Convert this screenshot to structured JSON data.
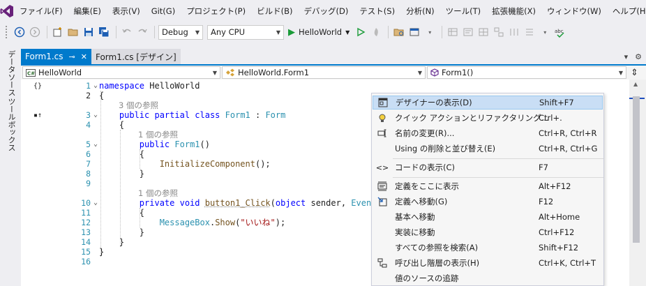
{
  "menu": [
    "ファイル(F)",
    "編集(E)",
    "表示(V)",
    "Git(G)",
    "プロジェクト(P)",
    "ビルド(B)",
    "デバッグ(D)",
    "テスト(S)",
    "分析(N)",
    "ツール(T)",
    "拡張機能(X)",
    "ウィンドウ(W)",
    "ヘルプ(H)"
  ],
  "toolbar": {
    "config": "Debug",
    "platform": "Any CPU",
    "run_label": "HelloWorld"
  },
  "side_tabs": [
    "データソース",
    "ツールボックス"
  ],
  "tabs": [
    {
      "label": "Form1.cs",
      "pin": "⊸",
      "close": "✕"
    },
    {
      "label": "Form1.cs [デザイン]"
    }
  ],
  "nav": {
    "project": "HelloWorld",
    "class": "HelloWorld.Form1",
    "member": "Form1()"
  },
  "code": {
    "line_numbers": [
      "1",
      "2",
      "3",
      "4",
      "5",
      "6",
      "7",
      "8",
      "9",
      "10",
      "11",
      "12",
      "13",
      "14",
      "15",
      "16"
    ],
    "l1_kw": "namespace",
    "l1_name": " HelloWorld",
    "l2": "{",
    "lens_3": "3 個の参照",
    "l3_kw": "public partial class",
    "l3_type": "Form1",
    "l3_sep": " : ",
    "l3_base": "Form",
    "l4": "{",
    "lens_5": "1 個の参照",
    "l5_kw": "public",
    "l5_fn": "Form1",
    "l5_rest": "()",
    "l6": "{",
    "l7_fn": "InitializeComponent",
    "l7_rest": "();",
    "l8": "}",
    "lens_10": "1 個の参照",
    "l10_kw": "private void",
    "l10_fn": "button1_Click",
    "l10_p1": "(",
    "l10_kw2": "object",
    "l10_p2": " sender, ",
    "l10_type": "EventA",
    "l11": "{",
    "l12_type": "MessageBox",
    "l12_dot": ".",
    "l12_fn": "Show",
    "l12_p1": "(",
    "l12_str": "\"いいね\"",
    "l12_p2": ");",
    "l13": "}",
    "l14": "}",
    "l15": "}"
  },
  "context_menu": [
    {
      "label": "デザイナーの表示(D)",
      "shortcut": "Shift+F7",
      "icon": "designer-icon"
    },
    {
      "label": "クイック アクションとリファクタリング...",
      "shortcut": "Ctrl+.",
      "icon": "lightbulb-icon"
    },
    {
      "label": "名前の変更(R)...",
      "shortcut": "Ctrl+R, Ctrl+R",
      "icon": "rename-icon"
    },
    {
      "label": "Using の削除と並び替え(E)",
      "shortcut": "Ctrl+R, Ctrl+G",
      "icon": ""
    },
    {
      "label": "コードの表示(C)",
      "shortcut": "F7",
      "icon": "code-icon"
    },
    {
      "label": "定義をここに表示",
      "shortcut": "Alt+F12",
      "icon": "peek-icon"
    },
    {
      "label": "定義へ移動(G)",
      "shortcut": "F12",
      "icon": "goto-icon"
    },
    {
      "label": "基本へ移動",
      "shortcut": "Alt+Home",
      "icon": ""
    },
    {
      "label": "実装に移動",
      "shortcut": "Ctrl+F12",
      "icon": ""
    },
    {
      "label": "すべての参照を検索(A)",
      "shortcut": "Shift+F12",
      "icon": ""
    },
    {
      "label": "呼び出し階層の表示(H)",
      "shortcut": "Ctrl+K, Ctrl+T",
      "icon": "hierarchy-icon"
    },
    {
      "label": "値のソースの追跡",
      "shortcut": "",
      "icon": ""
    }
  ],
  "colors": {
    "accent": "#007acc",
    "keyword": "#0000ff",
    "type": "#2b91af",
    "string": "#a31515",
    "method": "#74531f"
  }
}
